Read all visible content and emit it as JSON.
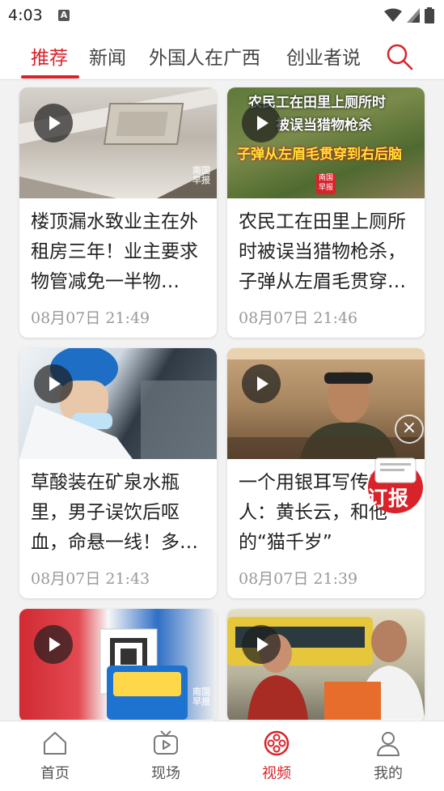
{
  "status": {
    "time": "4:03",
    "notif_letter": "A"
  },
  "tabs": [
    {
      "label": "推荐",
      "active": true
    },
    {
      "label": "新闻"
    },
    {
      "label": "外国人在广西"
    },
    {
      "label": "创业者说"
    }
  ],
  "cards": [
    {
      "title": "楼顶漏水致业主在外租房三年！业主要求物管减免一半物…",
      "time": "08月07日 21:49",
      "watermark": "南国早报"
    },
    {
      "title": "农民工在田里上厕所时被误当猎物枪杀，子弹从左眉毛贯穿…",
      "time": "08月07日 21:46",
      "overlay_line1": "农民工在田里上厕所时",
      "overlay_line2": "被误当猎物枪杀",
      "overlay_line3": "子弹从左眉毛贯穿到右后脑",
      "badge": "南国早报"
    },
    {
      "title": "草酸装在矿泉水瓶里，男子误饮后呕血，命悬一线！多…",
      "time": "08月07日 21:43"
    },
    {
      "title": "一个用银耳写传奇的人：黄长云，和他的“猫千岁”",
      "time": "08月07日 21:39"
    },
    {
      "watermark": "南国早报"
    },
    {}
  ],
  "float_badge": {
    "label": "订报"
  },
  "bottom_nav": [
    {
      "label": "首页"
    },
    {
      "label": "现场"
    },
    {
      "label": "视频",
      "active": true
    },
    {
      "label": "我的"
    }
  ],
  "colors": {
    "accent": "#d8232a"
  }
}
